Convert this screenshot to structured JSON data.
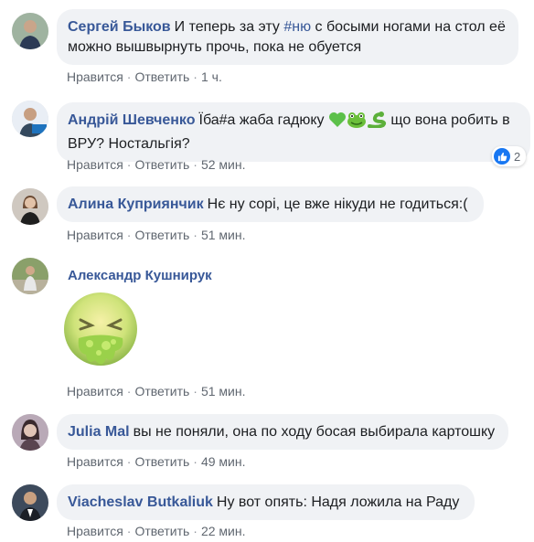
{
  "comments": [
    {
      "author": "Сергей Быков",
      "text_before": "И теперь за эту ",
      "hashtag": "#ню",
      "text_after": " с босыми ногами на стол её можно вышвырнуть прочь, пока не обуется",
      "like": "Нравится",
      "reply": "Ответить",
      "time": "1 ч."
    },
    {
      "author": "Андрій Шевченко",
      "text_before": "Їба#а жаба гадюку",
      "text_after": " що вона робить в ВРУ? Ностальгія?",
      "emojis": [
        "green-heart-icon",
        "frog-icon",
        "snake-icon"
      ],
      "like": "Нравится",
      "reply": "Ответить",
      "time": "52 мин.",
      "reaction_count": "2"
    },
    {
      "author": "Алина Куприянчик",
      "text": "Нє ну сорі, це вже нікуди не годиться:(",
      "like": "Нравится",
      "reply": "Ответить",
      "time": "51 мин."
    },
    {
      "author": "Александр Кушнирук",
      "sticker": "vomit-face-sticker",
      "like": "Нравится",
      "reply": "Ответить",
      "time": "51 мин."
    },
    {
      "author": "Julia Mal",
      "text": "вы не поняли, она по ходу босая выбирала картошку",
      "like": "Нравится",
      "reply": "Ответить",
      "time": "49 мин."
    },
    {
      "author": "Viacheslav Butkaliuk",
      "text": "Ну вот опять: Надя ложила на Раду",
      "like": "Нравится",
      "reply": "Ответить",
      "time": "22 мин."
    }
  ],
  "colors": {
    "author": "#385898",
    "bubble": "#f0f2f5",
    "meta": "#606770",
    "like_badge": "#1877f2"
  }
}
